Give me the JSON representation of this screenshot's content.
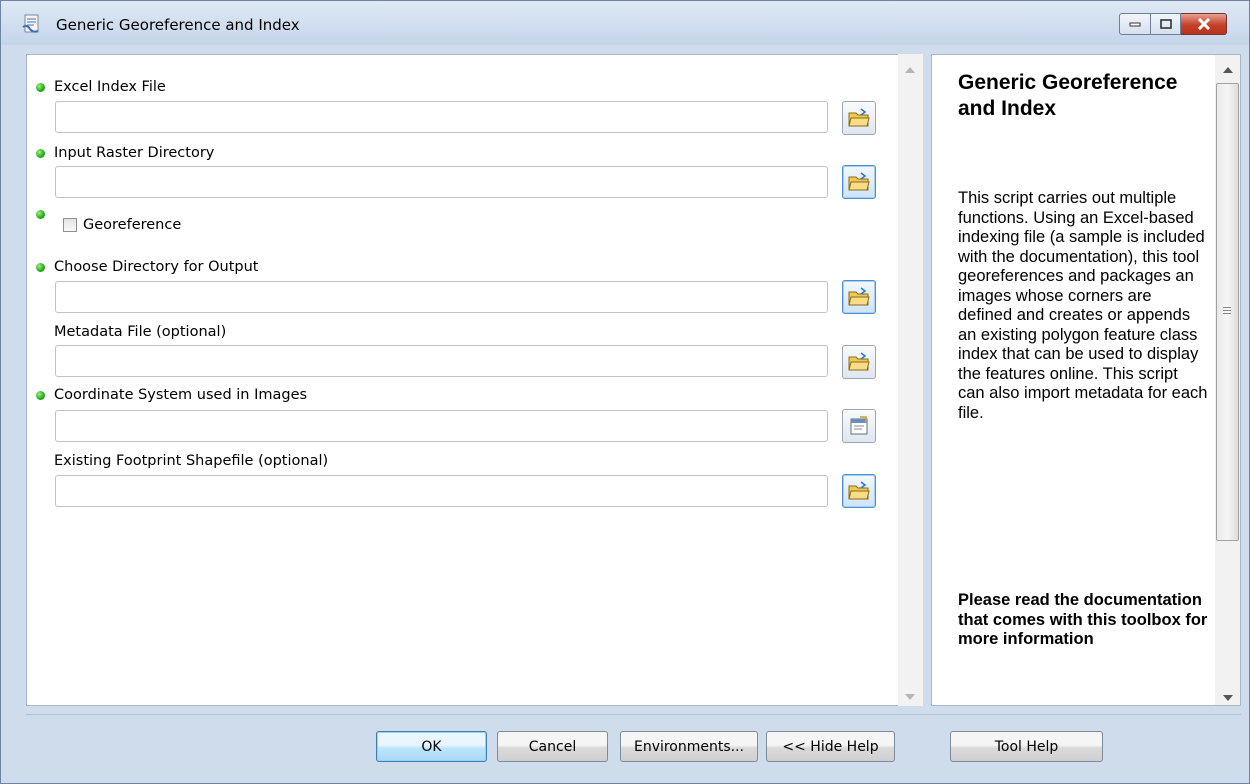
{
  "window": {
    "title": "Generic Georeference and Index"
  },
  "params": [
    {
      "label": "Excel Index File",
      "required": true,
      "value": ""
    },
    {
      "label": "Input Raster Directory",
      "required": true,
      "value": ""
    },
    {
      "label": "Georeference",
      "required": true,
      "checked": false
    },
    {
      "label": "Choose Directory for Output",
      "required": true,
      "value": ""
    },
    {
      "label": "Metadata File (optional)",
      "required": false,
      "value": ""
    },
    {
      "label": "Coordinate System used in Images",
      "required": true,
      "value": ""
    },
    {
      "label": "Existing Footprint Shapefile (optional)",
      "required": false,
      "value": ""
    }
  ],
  "help": {
    "title": "Generic Georeference and Index",
    "body": "This script carries out multiple functions. Using an Excel-based indexing file (a sample is included with the documentation), this tool georeferences and packages an images whose corners are defined and creates or appends an existing polygon feature class index that can be used to display the features online. This script can also import metadata for each file.",
    "note": "Please read the documentation that comes with this toolbox for more information"
  },
  "buttons": {
    "ok": "OK",
    "cancel": "Cancel",
    "environments": "Environments...",
    "hide_help": "<< Hide Help",
    "tool_help": "Tool Help"
  },
  "icons": {
    "app": "script-tool-icon",
    "browse": "open-folder-icon",
    "coordinate": "properties-icon",
    "required": "green-dot-icon"
  },
  "colors": {
    "required_dot": "#23a81b",
    "title_bar": "#cfdcec",
    "close_button": "#c5402a"
  }
}
